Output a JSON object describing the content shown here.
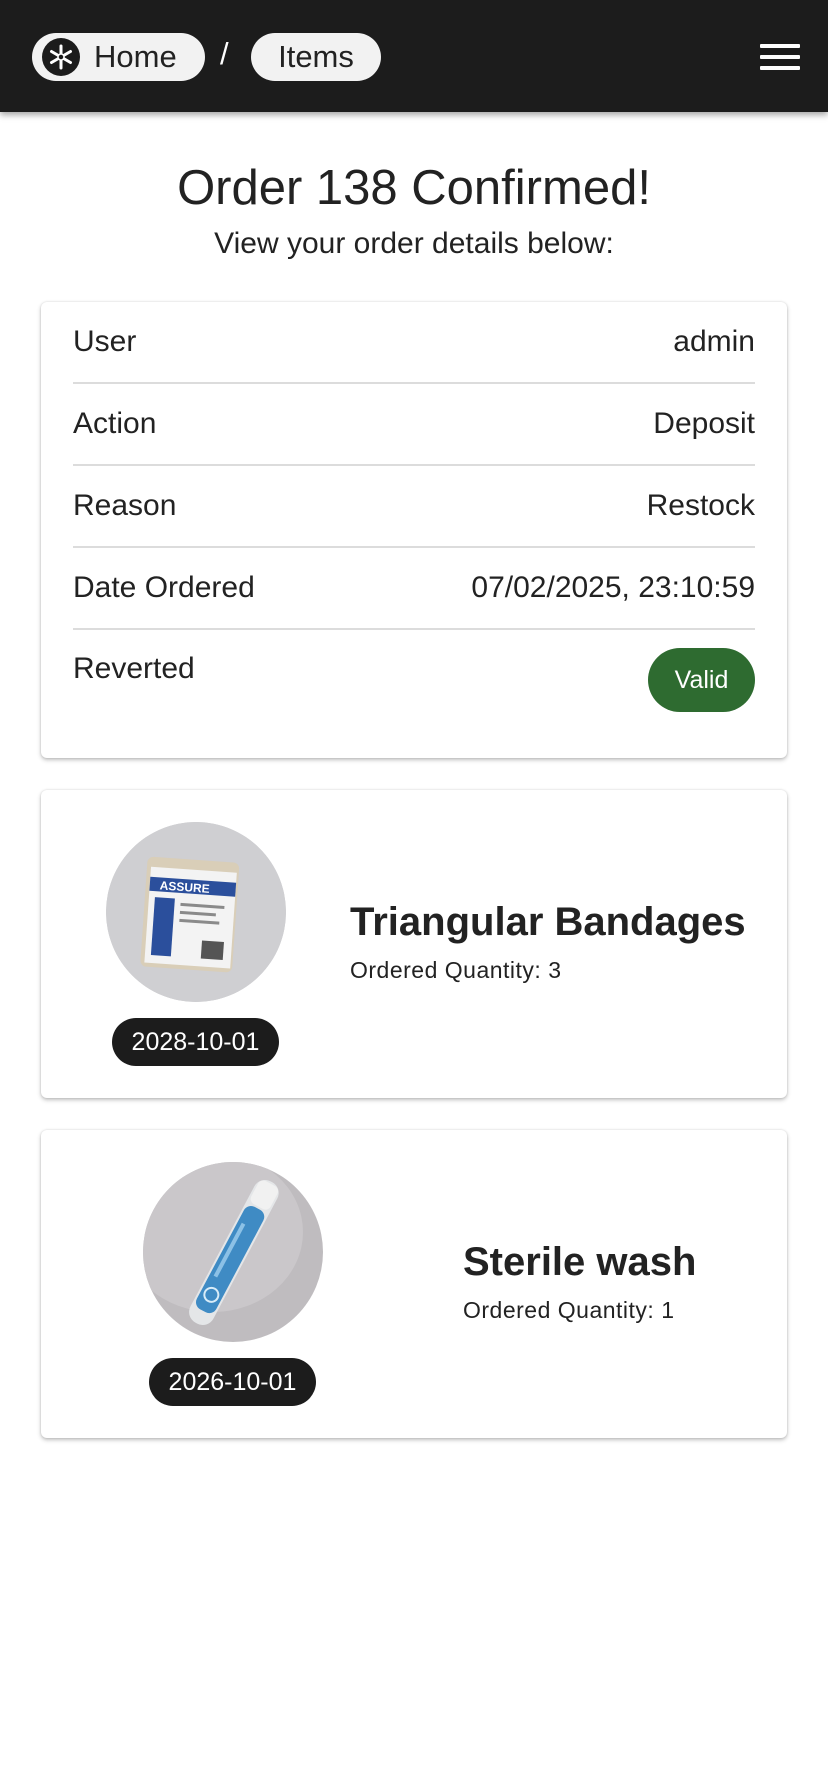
{
  "header": {
    "breadcrumbs": [
      {
        "label": "Home",
        "icon": "star-of-life-logo-icon"
      },
      {
        "label": "Items"
      }
    ],
    "separator": "/",
    "menu_icon": "hamburger-menu-icon"
  },
  "page": {
    "title": "Order 138 Confirmed!",
    "subtitle": "View your order details below:"
  },
  "details": {
    "rows": [
      {
        "label": "User",
        "value": "admin"
      },
      {
        "label": "Action",
        "value": "Deposit"
      },
      {
        "label": "Reason",
        "value": "Restock"
      },
      {
        "label": "Date Ordered",
        "value": "07/02/2025, 23:10:59"
      },
      {
        "label": "Reverted",
        "value": "Valid"
      }
    ],
    "valid_badge_color": "#2e6b30"
  },
  "items": [
    {
      "name": "Triangular Bandages",
      "quantity": "Ordered Quantity: 3",
      "expiry": "2028-10-01",
      "image_icon": "bandage-package-photo"
    },
    {
      "name": "Sterile wash",
      "quantity": "Ordered Quantity: 1",
      "expiry": "2026-10-01",
      "image_icon": "sterile-wash-tube-photo"
    }
  ],
  "colors": {
    "appbar": "#1c1c1c",
    "chip": "#f2f2f2",
    "accent_valid": "#2e6b30"
  }
}
